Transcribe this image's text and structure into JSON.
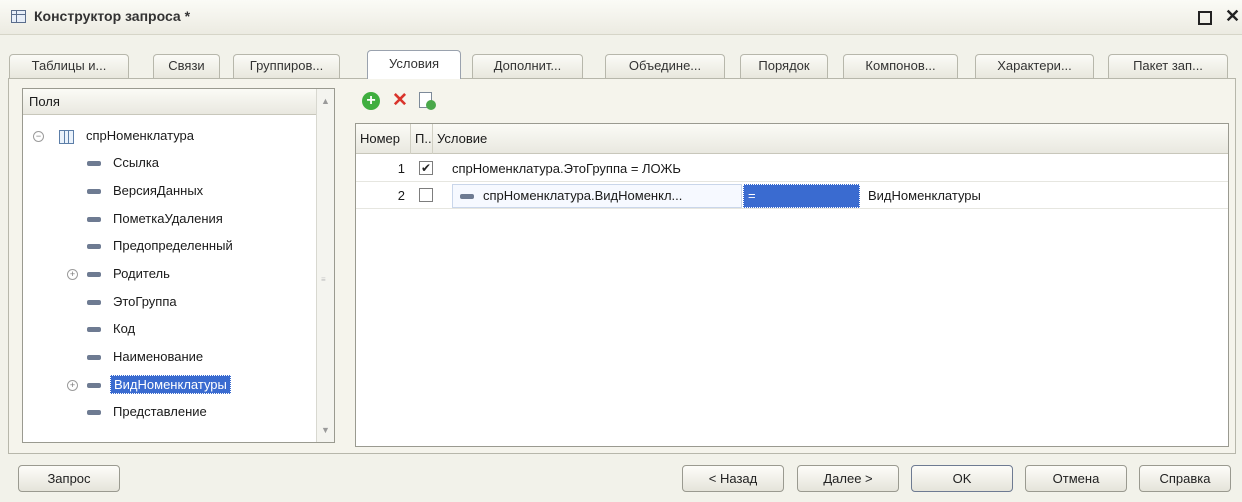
{
  "window": {
    "title": "Конструктор запроса *"
  },
  "tabs": [
    {
      "label": "Таблицы и..."
    },
    {
      "label": "Связи"
    },
    {
      "label": "Группиров..."
    },
    {
      "label": "Условия",
      "active": true
    },
    {
      "label": "Дополнит..."
    },
    {
      "label": "Объедине..."
    },
    {
      "label": "Порядок"
    },
    {
      "label": "Компонов..."
    },
    {
      "label": "Характери..."
    },
    {
      "label": "Пакет зап..."
    }
  ],
  "fields_panel": {
    "header": "Поля",
    "root": "спрНоменклатура",
    "items": [
      {
        "label": "Ссылка"
      },
      {
        "label": "ВерсияДанных"
      },
      {
        "label": "ПометкаУдаления"
      },
      {
        "label": "Предопределенный"
      },
      {
        "label": "Родитель",
        "expandable": true
      },
      {
        "label": "ЭтоГруппа"
      },
      {
        "label": "Код"
      },
      {
        "label": "Наименование"
      },
      {
        "label": "ВидНоменклатуры",
        "expandable": true,
        "selected": true
      },
      {
        "label": "Представление"
      }
    ]
  },
  "toolbar": {
    "icons": [
      "add-icon",
      "delete-icon",
      "copy-icon"
    ]
  },
  "conditions": {
    "columns": {
      "number": "Номер",
      "flag": "П..",
      "condition": "Условие"
    },
    "rows": [
      {
        "number": "1",
        "checked": true,
        "condition": "спрНоменклатура.ЭтоГруппа = ЛОЖЬ"
      },
      {
        "number": "2",
        "checked": false,
        "left": "спрНоменклатура.ВидНоменкл...",
        "operator": "=",
        "right": "ВидНоменклатуры"
      }
    ],
    "check_mark": "✔"
  },
  "buttons": {
    "query": "Запрос",
    "back": "< Назад",
    "next": "Далее >",
    "ok": "OK",
    "cancel": "Отмена",
    "help": "Справка"
  },
  "colors": {
    "selection": "#3a6bd0",
    "panel": "#f2f2ea"
  }
}
